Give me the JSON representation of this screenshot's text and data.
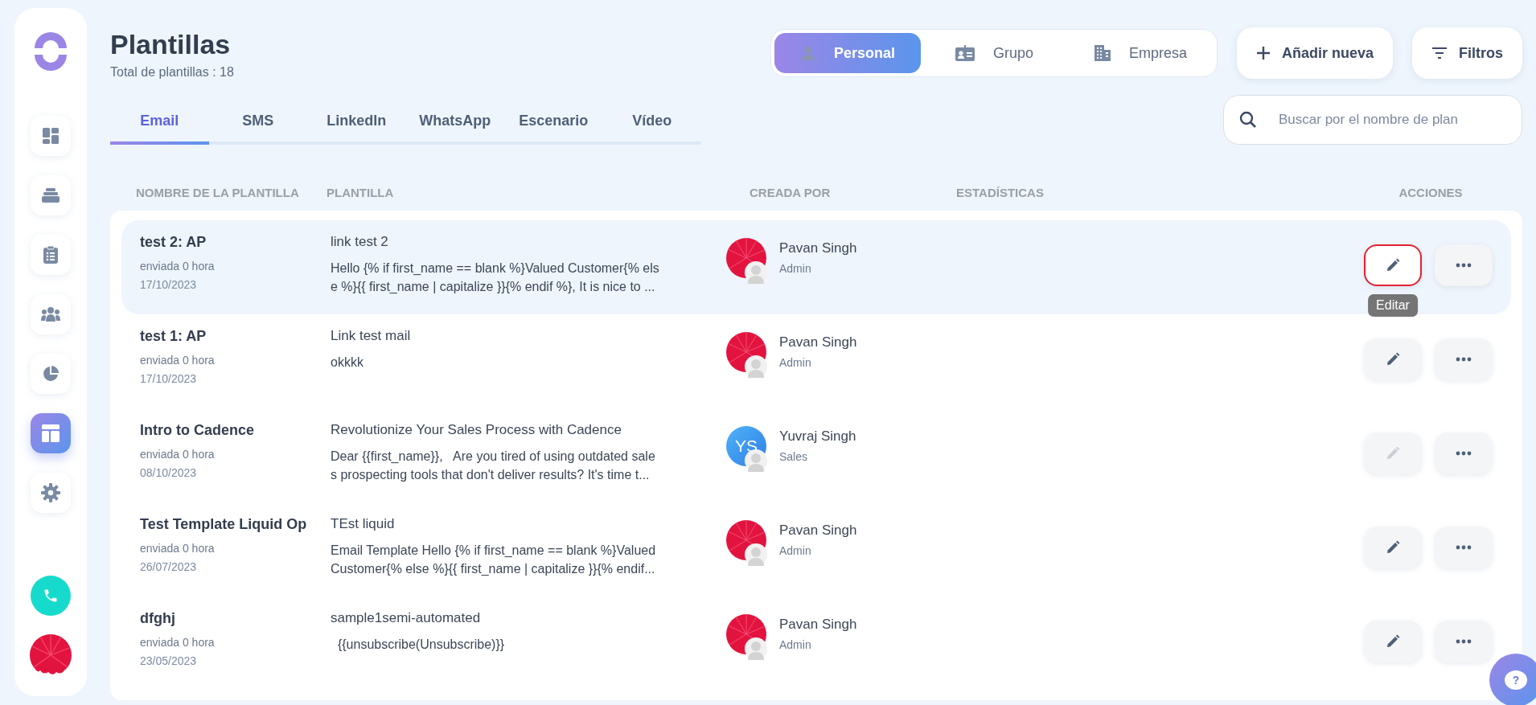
{
  "sidebar": {
    "items": [
      {
        "kind": "dashboard",
        "selected": false
      },
      {
        "kind": "inbox",
        "selected": false
      },
      {
        "kind": "clipboard",
        "selected": false
      },
      {
        "kind": "people",
        "selected": false
      },
      {
        "kind": "pie",
        "selected": false
      },
      {
        "kind": "template",
        "selected": true
      },
      {
        "kind": "settings",
        "selected": false
      }
    ]
  },
  "header": {
    "title": "Plantillas",
    "subtitle": "Total de plantillas : 18"
  },
  "owner_filter": [
    {
      "label": "Personal",
      "kind": "person",
      "selected": true
    },
    {
      "label": "Grupo",
      "kind": "group",
      "selected": false
    },
    {
      "label": "Empresa",
      "kind": "company",
      "selected": false
    }
  ],
  "add_button": {
    "label": "Añadir nueva"
  },
  "filter_button": {
    "label": "Filtros"
  },
  "tabs": [
    {
      "label": "Email",
      "selected": true
    },
    {
      "label": "SMS",
      "selected": false
    },
    {
      "label": "LinkedIn",
      "selected": false
    },
    {
      "label": "WhatsApp",
      "selected": false
    },
    {
      "label": "Escenario",
      "selected": false
    },
    {
      "label": "Vídeo",
      "selected": false
    }
  ],
  "search": {
    "placeholder": "Buscar por el nombre de plan"
  },
  "table": {
    "columns": [
      "NOMBRE DE LA PLANTILLA",
      "PLANTILLA",
      "CREADA POR",
      "ESTADÍSTICAS",
      "ACCIONES"
    ],
    "rows": [
      {
        "name": "test 2: AP",
        "sent": "enviada 0 hora",
        "date": "17/10/2023",
        "subject": "link test 2",
        "body_lines": [
          "Hello {% if first_name == blank %}Valued Customer{% els",
          "e %}{{ first_name | capitalize }}{% endif %}, It is nice to ..."
        ],
        "creator": "Pavan Singh",
        "role": "Admin",
        "avatar": {
          "kind": "picture"
        },
        "selected": true,
        "edit": {
          "disabled": false,
          "focused": true,
          "tooltip": "Editar"
        }
      },
      {
        "name": "test 1: AP",
        "sent": "enviada 0 hora",
        "date": "17/10/2023",
        "subject": "Link test mail",
        "body_lines": [
          "okkkk"
        ],
        "creator": "Pavan Singh",
        "role": "Admin",
        "avatar": {
          "kind": "picture"
        },
        "selected": false,
        "edit": {
          "disabled": false,
          "focused": false
        }
      },
      {
        "name": "Intro to Cadence",
        "sent": "enviada 0 hora",
        "date": "08/10/2023",
        "subject": "Revolutionize Your Sales Process with Cadence",
        "body_lines": [
          "Dear {{first_name}},   Are you tired of using outdated sale",
          "s prospecting tools that don't deliver results? It's time t..."
        ],
        "creator": "Yuvraj Singh",
        "role": "Sales",
        "avatar": {
          "kind": "initials",
          "initials": "YS"
        },
        "selected": false,
        "edit": {
          "disabled": true,
          "focused": false
        }
      },
      {
        "name": "Test Template Liquid Op",
        "sent": "enviada 0 hora",
        "date": "26/07/2023",
        "subject": "TEst liquid",
        "body_lines": [
          "Email Template Hello {% if first_name == blank %}Valued",
          "Customer{% else %}{{ first_name | capitalize }}{% endif..."
        ],
        "creator": "Pavan Singh",
        "role": "Admin",
        "avatar": {
          "kind": "picture"
        },
        "selected": false,
        "edit": {
          "disabled": false,
          "focused": false
        }
      },
      {
        "name": "dfghj",
        "sent": "enviada 0 hora",
        "date": "23/05/2023",
        "subject": "sample1semi-automated",
        "body_lines": [
          "  {{unsubscribe(Unsubscribe)}}"
        ],
        "creator": "Pavan Singh",
        "role": "Admin",
        "avatar": {
          "kind": "picture"
        },
        "selected": false,
        "edit": {
          "disabled": false,
          "focused": false
        }
      }
    ]
  },
  "help_button": {
    "label": "?"
  }
}
